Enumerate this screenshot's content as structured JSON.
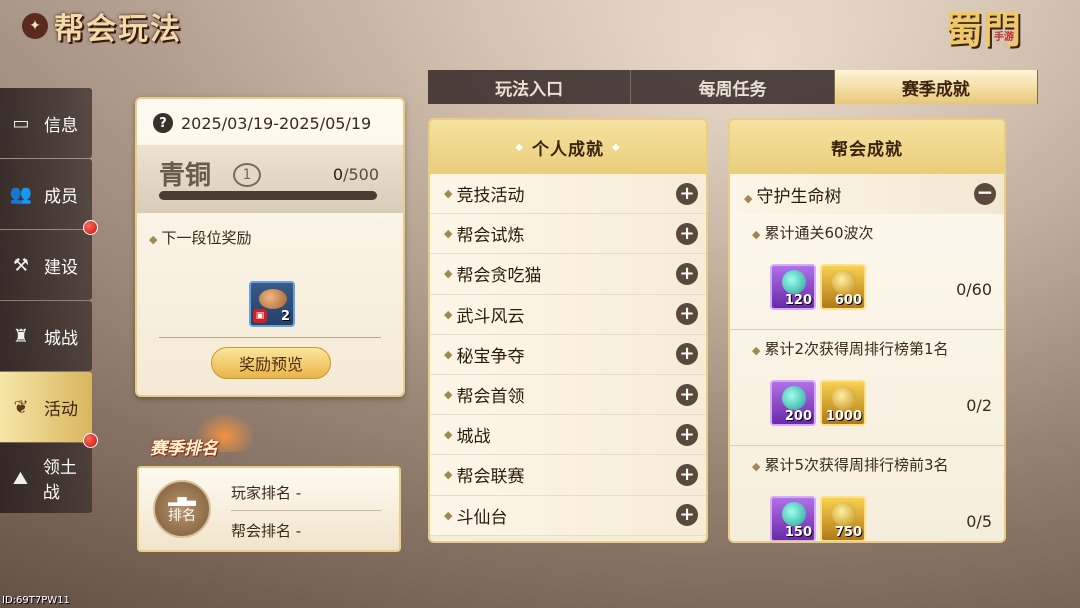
{
  "title": "帮会玩法",
  "logo": {
    "text": "蜀門",
    "tag": "手游"
  },
  "nav": [
    {
      "label": "信息",
      "icon": "chat-icon",
      "glyph": "▭",
      "active": false,
      "dot": false
    },
    {
      "label": "成员",
      "icon": "members-icon",
      "glyph": "👥",
      "active": false,
      "dot": false
    },
    {
      "label": "建设",
      "icon": "hammer-icon",
      "glyph": "⚒",
      "active": false,
      "dot": true
    },
    {
      "label": "城战",
      "icon": "castle-icon",
      "glyph": "♜",
      "active": false,
      "dot": false
    },
    {
      "label": "活动",
      "icon": "flame-icon",
      "glyph": "❦",
      "active": true,
      "dot": false
    },
    {
      "label": "领土战",
      "icon": "mountain-icon",
      "glyph": "⛰",
      "active": false,
      "dot": true
    }
  ],
  "tabs": [
    {
      "label": "玩法入口",
      "active": false
    },
    {
      "label": "每周任务",
      "active": false
    },
    {
      "label": "赛季成就",
      "active": true
    }
  ],
  "season": {
    "date_range": "2025/03/19-2025/05/19",
    "rank_name": "青铜",
    "rank_level": "1",
    "progress_current": "0",
    "progress_total": "/500",
    "progress_fraction": 0,
    "next_reward_label": "下一段位奖励",
    "reward_count": "2",
    "preview_button": "奖励预览"
  },
  "ranking": {
    "header": "赛季排名",
    "badge_label": "排名",
    "player_rank": "玩家排名 -",
    "guild_rank": "帮会排名 -"
  },
  "personal": {
    "title": "个人成就",
    "items": [
      "竞技活动",
      "帮会试炼",
      "帮会贪吃猫",
      "武斗风云",
      "秘宝争夺",
      "帮会首领",
      "城战",
      "帮会联赛",
      "斗仙台"
    ]
  },
  "guild": {
    "title": "帮会成就",
    "section": "守护生命树",
    "tasks": [
      {
        "label": "累计通关60波次",
        "rewards": [
          "120",
          "600"
        ],
        "progress": "0/60"
      },
      {
        "label": "累计2次获得周排行榜第1名",
        "rewards": [
          "200",
          "1000"
        ],
        "progress": "0/2"
      },
      {
        "label": "累计5次获得周排行榜前3名",
        "rewards": [
          "150",
          "750"
        ],
        "progress": "0/5"
      }
    ]
  },
  "footer_id": "ID:69T7PW11"
}
